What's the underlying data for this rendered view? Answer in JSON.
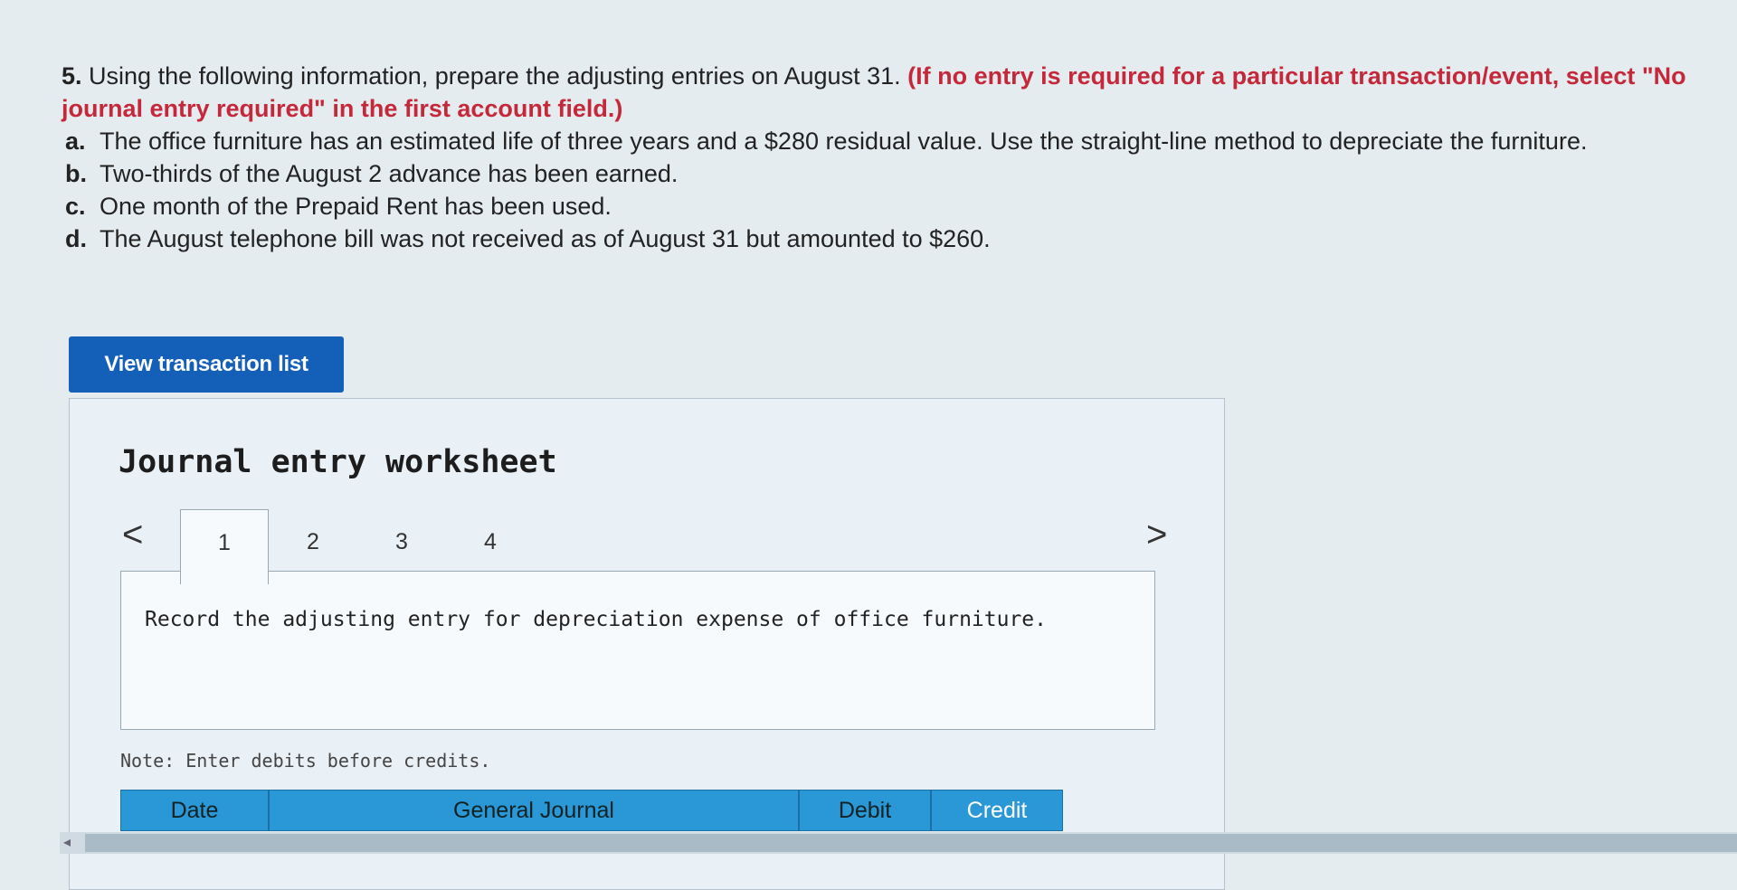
{
  "question": {
    "number": "5.",
    "intro": "Using the following information, prepare the adjusting entries on August 31.",
    "instruction": "(If no entry is required for a particular transaction/event, select \"No journal entry required\" in the first account field.)",
    "items": [
      {
        "letter": "a.",
        "text": "The office furniture has an estimated life of three years and a $280 residual value. Use the straight-line method to depreciate the furniture."
      },
      {
        "letter": "b.",
        "text": "Two-thirds of the August 2 advance has been earned."
      },
      {
        "letter": "c.",
        "text": "One month of the Prepaid Rent has been used."
      },
      {
        "letter": "d.",
        "text": "The August telephone bill was not received as of August 31 but amounted to $260."
      }
    ]
  },
  "view_button_label": "View transaction list",
  "worksheet": {
    "title": "Journal entry worksheet",
    "prev_label": "<",
    "next_label": ">",
    "tabs": [
      "1",
      "2",
      "3",
      "4"
    ],
    "active_tab": "1",
    "entry_instruction": "Record the adjusting entry for depreciation expense of office furniture.",
    "note": "Note: Enter debits before credits.",
    "columns": {
      "date": "Date",
      "general_journal": "General Journal",
      "debit": "Debit",
      "credit": "Credit"
    }
  },
  "colors": {
    "accent_blue": "#1460b8",
    "instruction_red": "#c4283a",
    "header_blue": "#2a97d6"
  }
}
